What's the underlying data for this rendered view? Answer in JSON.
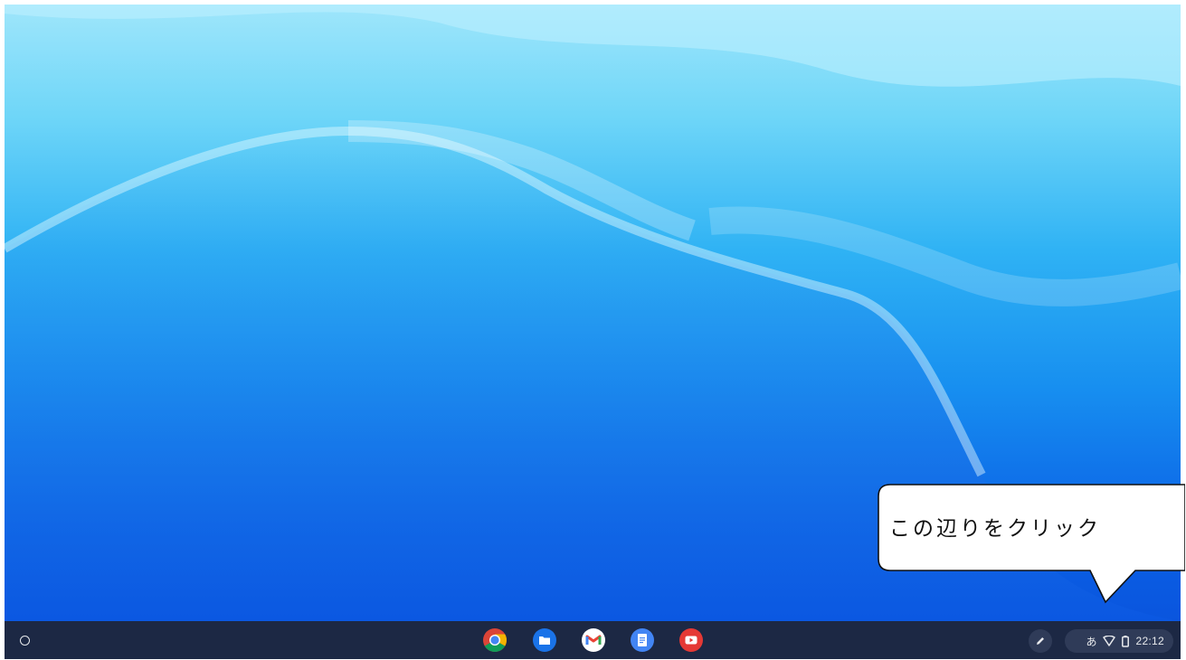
{
  "shelf": {
    "launcher_icon": "circle-launcher-icon",
    "apps": [
      {
        "name": "chrome-app-icon"
      },
      {
        "name": "files-app-icon"
      },
      {
        "name": "gmail-app-icon"
      },
      {
        "name": "docs-app-icon"
      },
      {
        "name": "youtube-app-icon"
      }
    ],
    "stylus_icon": "pen-icon",
    "status": {
      "ime": "あ",
      "wifi_icon": "wifi-icon",
      "battery_icon": "battery-icon",
      "time": "22:12"
    }
  },
  "callout": {
    "text": "この辺りをクリック"
  },
  "colors": {
    "shelf_bg": "#1c2844",
    "pill_bg": "#2f3b58",
    "wallpaper_top": "#9fe6fb",
    "wallpaper_bottom": "#0a55de"
  }
}
